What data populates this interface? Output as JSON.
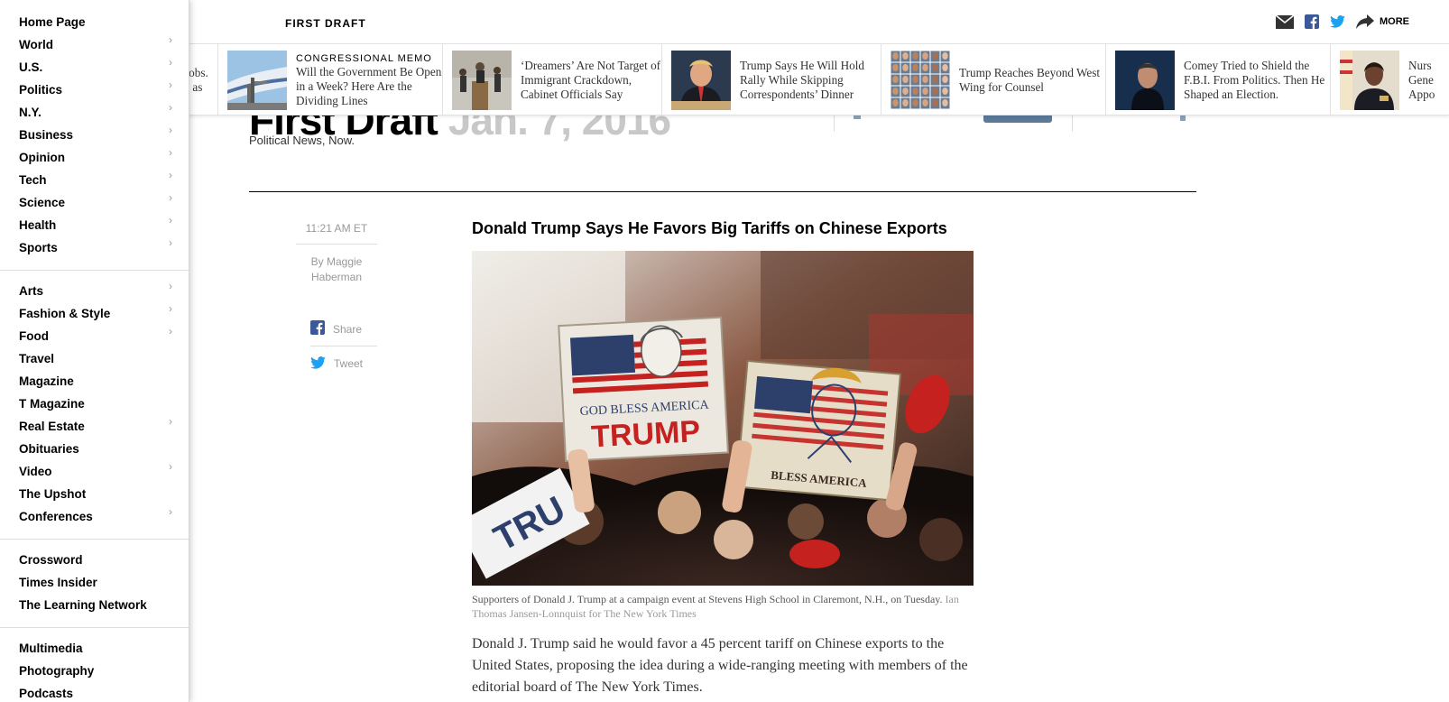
{
  "sidebar": {
    "groups": [
      {
        "items": [
          {
            "label": "Home Page",
            "has_chevron": false
          },
          {
            "label": "World",
            "has_chevron": true
          },
          {
            "label": "U.S.",
            "has_chevron": true
          },
          {
            "label": "Politics",
            "has_chevron": true
          },
          {
            "label": "N.Y.",
            "has_chevron": true
          },
          {
            "label": "Business",
            "has_chevron": true
          },
          {
            "label": "Opinion",
            "has_chevron": true
          },
          {
            "label": "Tech",
            "has_chevron": true
          },
          {
            "label": "Science",
            "has_chevron": true
          },
          {
            "label": "Health",
            "has_chevron": true
          },
          {
            "label": "Sports",
            "has_chevron": true
          }
        ]
      },
      {
        "items": [
          {
            "label": "Arts",
            "has_chevron": true
          },
          {
            "label": "Fashion & Style",
            "has_chevron": true
          },
          {
            "label": "Food",
            "has_chevron": true
          },
          {
            "label": "Travel",
            "has_chevron": false
          },
          {
            "label": "Magazine",
            "has_chevron": false
          },
          {
            "label": "T Magazine",
            "has_chevron": false
          },
          {
            "label": "Real Estate",
            "has_chevron": true
          },
          {
            "label": "Obituaries",
            "has_chevron": false
          },
          {
            "label": "Video",
            "has_chevron": true
          },
          {
            "label": "The Upshot",
            "has_chevron": false
          },
          {
            "label": "Conferences",
            "has_chevron": true
          }
        ]
      },
      {
        "items": [
          {
            "label": "Crossword",
            "has_chevron": false
          },
          {
            "label": "Times Insider",
            "has_chevron": false
          },
          {
            "label": "The Learning Network",
            "has_chevron": false
          }
        ]
      },
      {
        "items": [
          {
            "label": "Multimedia",
            "has_chevron": false
          },
          {
            "label": "Photography",
            "has_chevron": false
          },
          {
            "label": "Podcasts",
            "has_chevron": false
          }
        ]
      }
    ]
  },
  "topbar": {
    "section_title": "FIRST DRAFT",
    "more_label": "MORE",
    "icons": [
      "email-icon",
      "facebook-icon",
      "twitter-icon",
      "share-arrow-icon"
    ]
  },
  "ribbon": {
    "items": [
      {
        "kicker": "",
        "headline": "Jobs.\n't as",
        "thumb": "none"
      },
      {
        "kicker": "CONGRESSIONAL MEMO",
        "headline": "Will the Government Be Open in a Week? Here Are the Dividing Lines",
        "thumb": "air-force-one"
      },
      {
        "kicker": "",
        "headline": "‘Dreamers’ Are Not Target of Immigrant Crackdown, Cabinet Officials Say",
        "thumb": "podium"
      },
      {
        "kicker": "",
        "headline": "Trump Says He Will Hold Rally While Skipping Correspondents’ Dinner",
        "thumb": "portrait-trump"
      },
      {
        "kicker": "",
        "headline": "Trump Reaches Beyond West Wing for Counsel",
        "thumb": "headshot-grid"
      },
      {
        "kicker": "",
        "headline": "Comey Tried to Shield the F.B.I. From Politics. Then He Shaped an Election.",
        "thumb": "portrait-comey"
      },
      {
        "kicker": "",
        "headline": "Nurs Gene Appo",
        "thumb": "portrait-officer"
      }
    ]
  },
  "blog": {
    "name": "First Draft",
    "date": "Jan. 7, 2016",
    "tagline": "Political News, Now."
  },
  "post": {
    "time": "11:21 AM ET",
    "byline": "By Maggie Haberman",
    "share_label": "Share",
    "tweet_label": "Tweet",
    "headline": "Donald Trump Says He Favors Big Tariffs on Chinese Exports",
    "photo": {
      "sign1_line1": "GOD BLESS AMERICA",
      "sign1_line2": "TRUMP",
      "sign2_text": "BLESS AMERICA",
      "placard_text": "TRU"
    },
    "caption": "Supporters of Donald J. Trump at a campaign event at Stevens High School in Claremont, N.H., on Tuesday.",
    "credit": "Ian Thomas Jansen-Lonnquist for The New York Times",
    "body": "Donald J. Trump said he would favor a 45 percent tariff on Chinese exports to the United States, proposing the idea during a wide-ranging meeting with members of the editorial board of The New York Times."
  },
  "colors": {
    "facebook": "#3b5998",
    "twitter": "#1da1f2",
    "trump_red": "#c4211f",
    "flag_blue": "#2d3f6b"
  }
}
